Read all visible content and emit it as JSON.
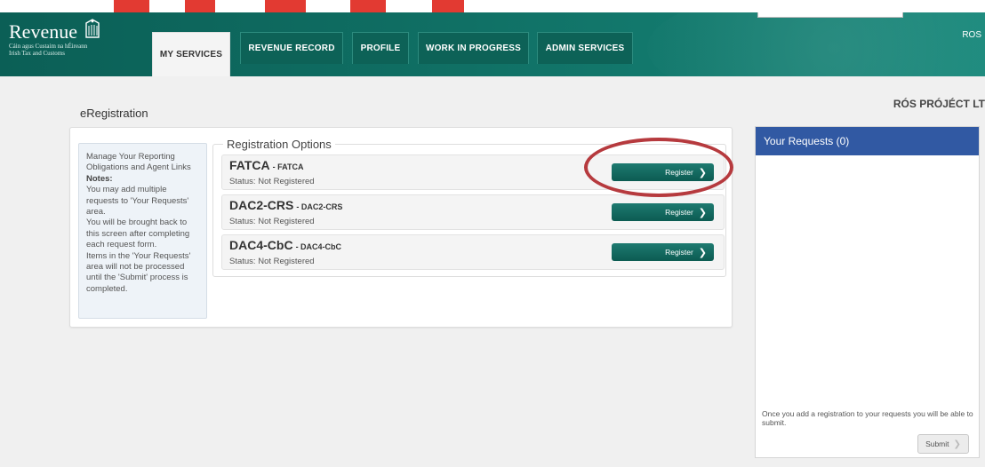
{
  "header": {
    "logo_word": "Revenue",
    "logo_sub1": "Cáin agus Custaim na hÉireann",
    "logo_sub2": "Irish Tax and Customs",
    "user_short": "ROS"
  },
  "tabs": [
    {
      "label": "MY SERVICES",
      "active": true
    },
    {
      "label": "REVENUE RECORD",
      "active": false
    },
    {
      "label": "PROFILE",
      "active": false
    },
    {
      "label": "WORK IN PROGRESS",
      "active": false
    },
    {
      "label": "ADMIN SERVICES",
      "active": false
    }
  ],
  "company": "RÓS PRÓJÉCT LT",
  "page_title": "eRegistration",
  "instructions": {
    "line1": "Manage Your Reporting Obligations and Agent Links",
    "notes_label": "Notes:",
    "note1": "You may add multiple requests to 'Your Requests' area.",
    "note2": "You will be brought back to this screen after completing each request form.",
    "note3": "Items in the 'Your Requests' area will not be processed until the 'Submit' process is completed."
  },
  "registration": {
    "legend": "Registration Options",
    "options": [
      {
        "name": "FATCA",
        "sub": "- FATCA",
        "status": "Status: Not Registered",
        "button": "Register"
      },
      {
        "name": "DAC2-CRS",
        "sub": "- DAC2-CRS",
        "status": "Status: Not Registered",
        "button": "Register"
      },
      {
        "name": "DAC4-CbC",
        "sub": "- DAC4-CbC",
        "status": "Status: Not Registered",
        "button": "Register"
      }
    ]
  },
  "requests": {
    "title": "Your Requests (0)",
    "note": "Once you add a registration to your requests you will be able to submit.",
    "submit_label": "Submit"
  },
  "colors": {
    "header_green": "#0f6d62",
    "register_button": "#0c5b52",
    "requests_header": "#3159a3",
    "highlight_ellipse": "#b63a3e"
  },
  "icons": {
    "chevron": "chevron-right-icon",
    "logo": "harp-icon"
  }
}
